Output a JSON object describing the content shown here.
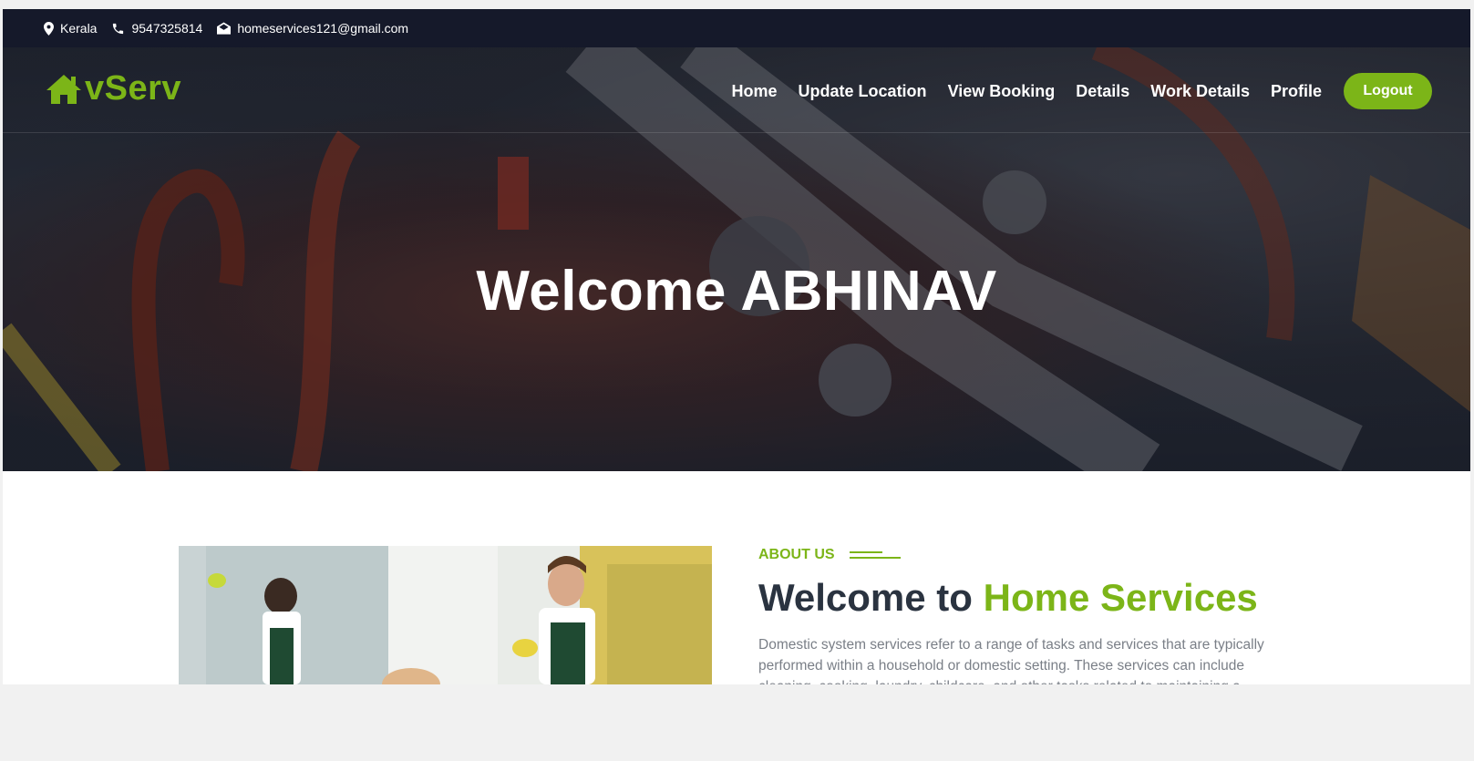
{
  "topbar": {
    "location": "Kerala",
    "phone": "9547325814",
    "email": "homeservices121@gmail.com"
  },
  "brand": {
    "logo_text": "vServ",
    "color": "#7cb518"
  },
  "nav": {
    "items": [
      "Home",
      "Update Location",
      "View Booking",
      "Details",
      "Work Details",
      "Profile"
    ],
    "logout": "Logout"
  },
  "hero": {
    "title": "Welcome ABHINAV"
  },
  "about": {
    "label": "ABOUT US",
    "heading_prefix": "Welcome to",
    "heading_accent": "Home Services",
    "text": "Domestic system services refer to a range of tasks and services that are typically performed within a household or domestic setting. These services can include cleaning, cooking, laundry, childcare, and other tasks related to maintaining a home."
  },
  "colors": {
    "topbar_bg": "#15192a",
    "accent": "#7cb518",
    "heading": "#2a3340"
  }
}
